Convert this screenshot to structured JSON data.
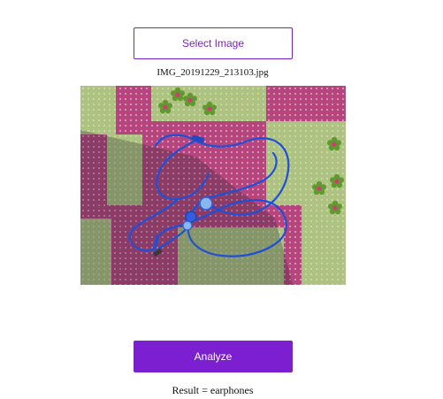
{
  "select_button": {
    "label": "Select Image"
  },
  "file": {
    "name": "IMG_20191229_213103.jpg"
  },
  "preview": {
    "subject": "earphones"
  },
  "analyze_button": {
    "label": "Analyze"
  },
  "result": {
    "prefix": "Result = ",
    "value": "earphones"
  },
  "colors": {
    "accent": "#7b1fd1",
    "background": "#ffffff",
    "text": "#111111"
  }
}
